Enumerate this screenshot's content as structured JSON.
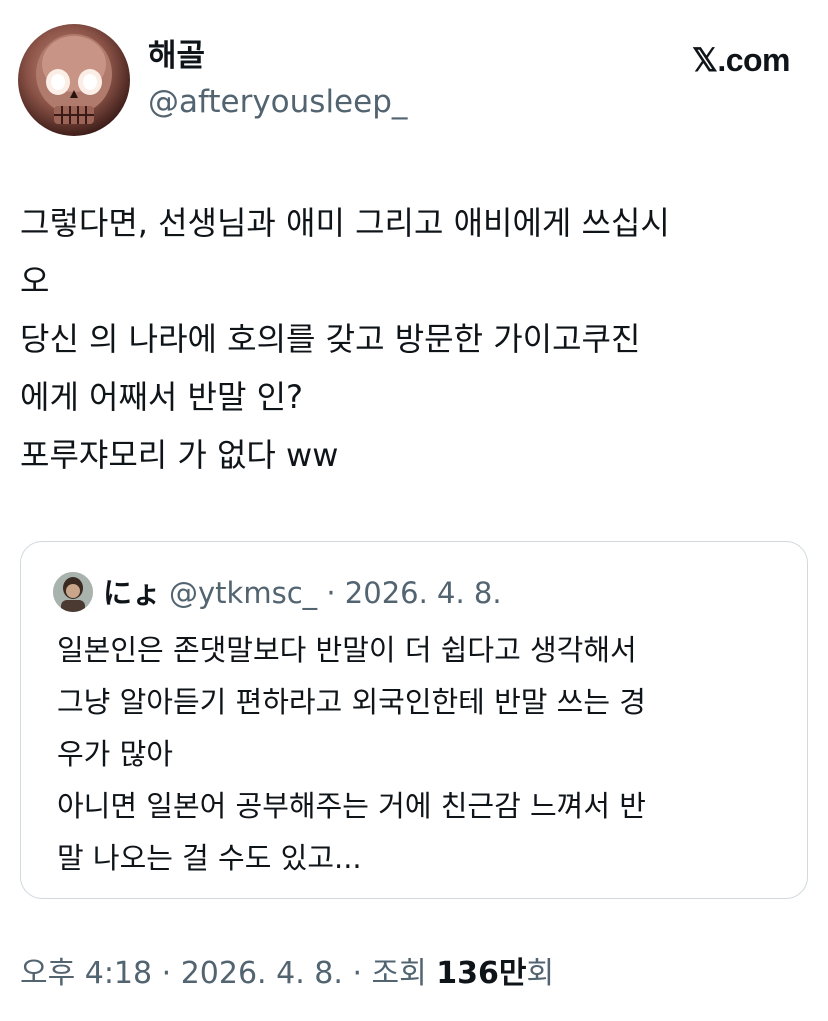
{
  "author": {
    "display_name": "해골",
    "handle": "@afteryousleep_",
    "avatar_icon": "skull-avatar"
  },
  "brand": {
    "label": "𝕏.com"
  },
  "tweet": {
    "lines": [
      "그렇다면, 선생님과 애미 그리고 애비에게 쓰십시",
      "오",
      "당신 의 나라에 호의를 갖고 방문한 가이고쿠진",
      "에게 어째서 반말 인?",
      "포루쟈모리 가 없다 ww"
    ]
  },
  "quote": {
    "avatar_icon": "profile-avatar",
    "name": "にょ",
    "meta": "@ytkmsc_ · 2026. 4. 8.",
    "lines": [
      "일본인은 존댓말보다 반말이 더 쉽다고 생각해서",
      "그냥 알아듣기 편하라고 외국인한테 반말 쓰는 경",
      "우가 많아",
      "아니면 일본어 공부해주는 거에 친근감 느껴서 반",
      "말 나오는 걸 수도 있고..."
    ]
  },
  "footer": {
    "time_date": "오후 4:18 · 2026. 4. 8. · 조회 ",
    "views_count": "136만",
    "views_suffix": "회"
  },
  "colors": {
    "text_primary": "#0f1419",
    "text_secondary": "#536471",
    "border": "#cfd9de",
    "background": "#ffffff"
  }
}
